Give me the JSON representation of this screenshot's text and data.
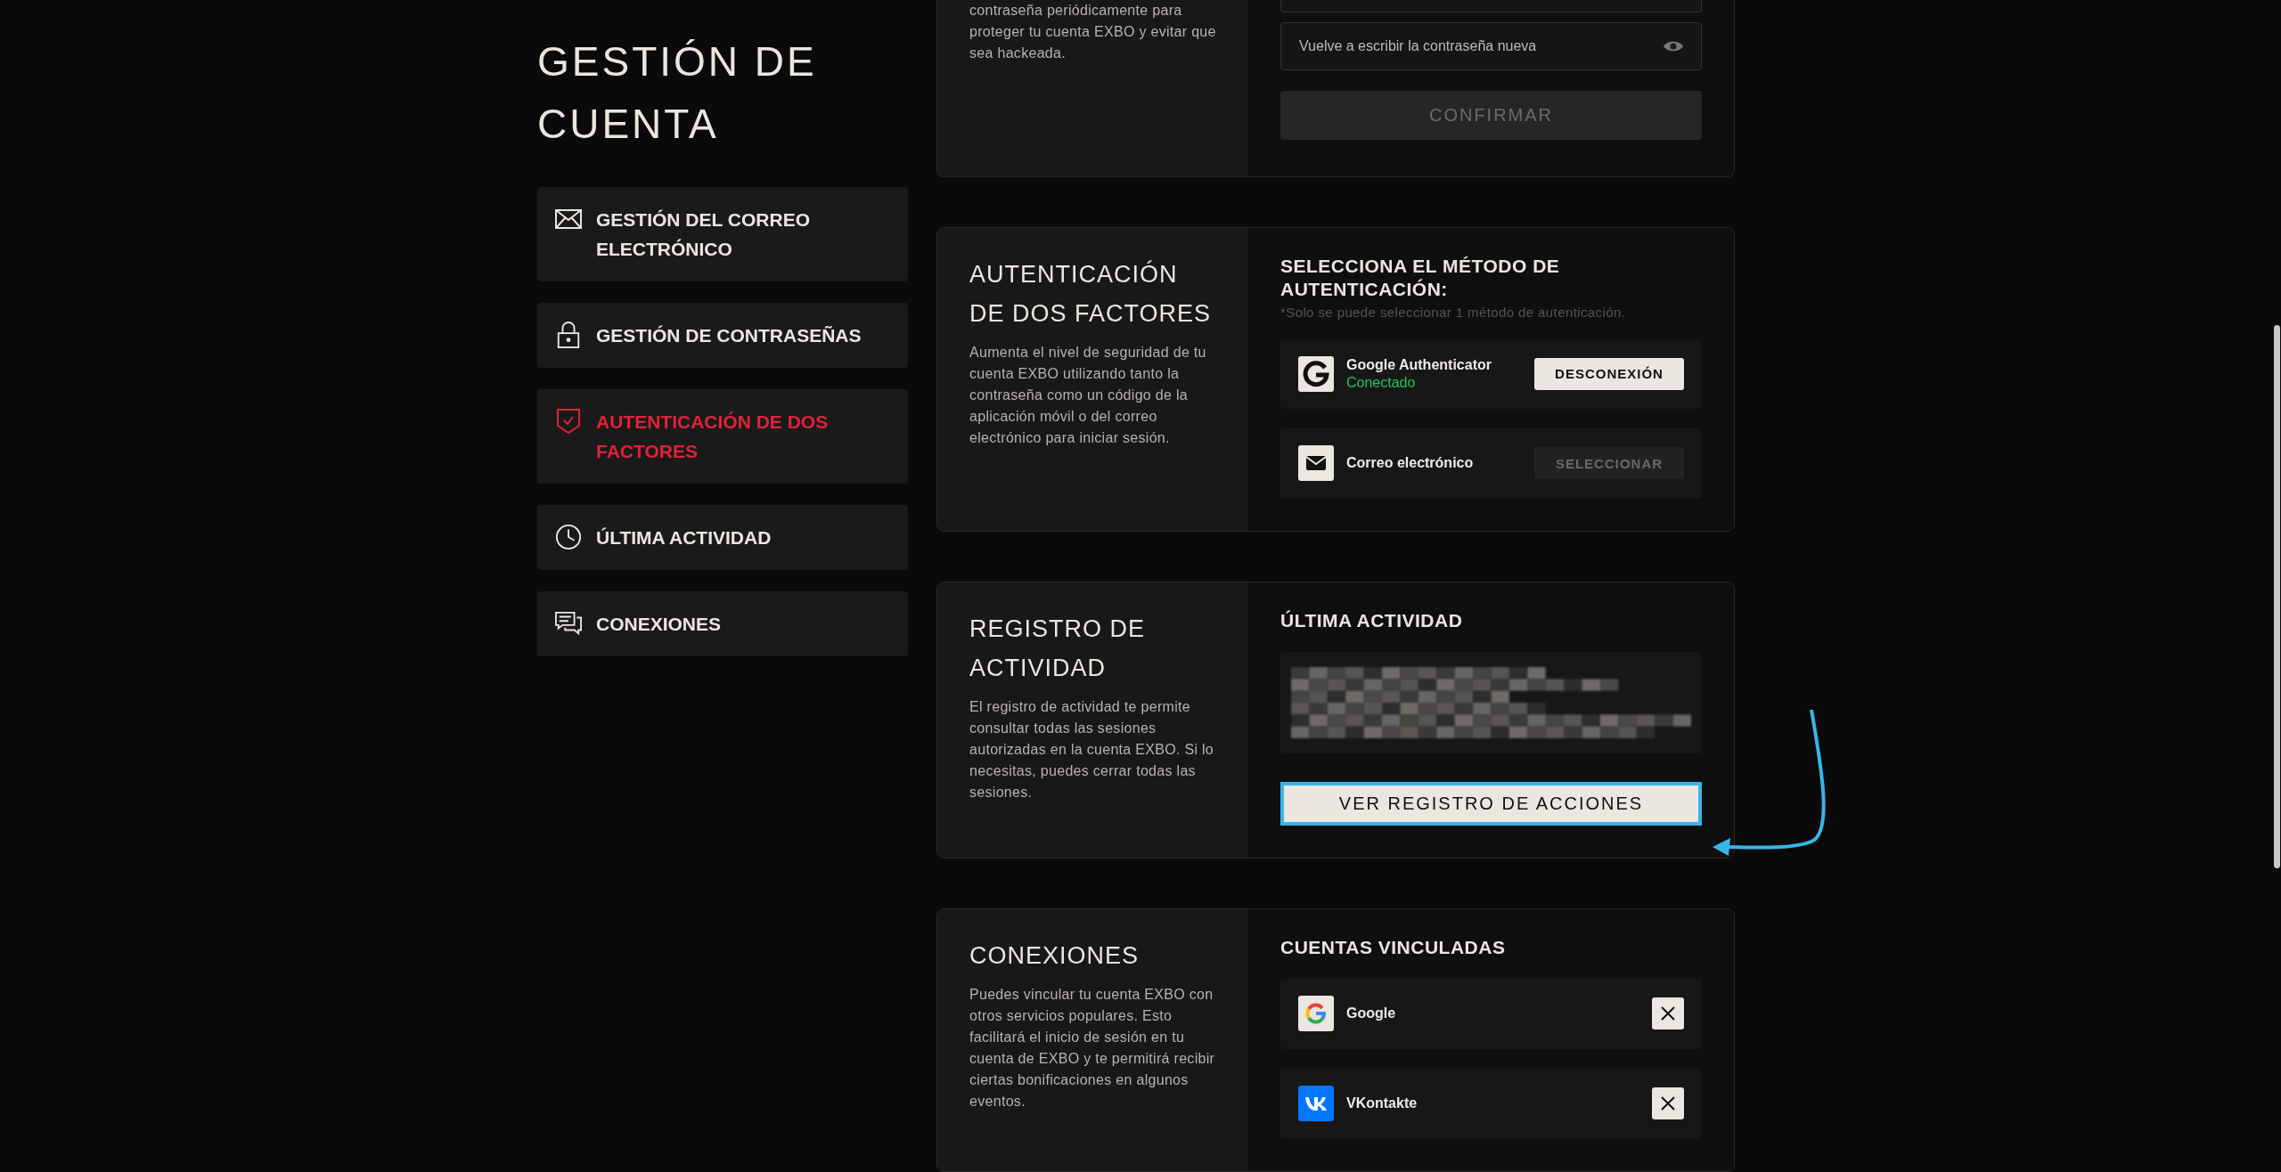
{
  "sidebar": {
    "title": "GESTIÓN DE CUENTA",
    "items": [
      {
        "label": "GESTIÓN DEL CORREO ELECTRÓNICO",
        "kind": "mail",
        "selected": false
      },
      {
        "label": "GESTIÓN DE CONTRASEÑAS",
        "kind": "lock",
        "selected": false
      },
      {
        "label": "AUTENTICACIÓN DE DOS FACTORES",
        "kind": "shield",
        "selected": true
      },
      {
        "label": "ÚLTIMA ACTIVIDAD",
        "kind": "clock",
        "selected": false
      },
      {
        "label": "CONEXIONES",
        "kind": "chat",
        "selected": false
      }
    ]
  },
  "password": {
    "description": "contraseña periódicamente para proteger tu cuenta EXBO y evitar que sea hackeada.",
    "repeat_field": {
      "placeholder": "Vuelve a escribir la contraseña nueva"
    },
    "confirm_button": {
      "label": "CONFIRMAR",
      "disabled": true
    }
  },
  "two_factor": {
    "title": "AUTENTICACIÓN DE DOS FACTORES",
    "description": "Aumenta el nivel de seguridad de tu cuenta EXBO utilizando tanto la contraseña como un código de la aplicación móvil o del correo electrónico para iniciar sesión.",
    "heading": "SELECCIONA EL MÉTODO DE AUTENTICACIÓN:",
    "note": "*Solo se puede seleccionar 1 método de autenticación.",
    "methods": [
      {
        "name": "Google Authenticator",
        "status": "Conectado",
        "kind": "authenticator",
        "button": "DESCONEXIÓN",
        "connected": true
      },
      {
        "name": "Correo electrónico",
        "kind": "mail",
        "button": "SELECCIONAR",
        "connected": false
      }
    ]
  },
  "activity": {
    "title": "REGISTRO DE ACTIVIDAD",
    "description": "El registro de actividad te permite consultar todas las sesiones autorizadas en la cuenta EXBO. Si lo necesitas, puedes cerrar todas las sesiones.",
    "heading": "ÚLTIMA ACTIVIDAD",
    "button": {
      "label": "VER REGISTRO DE ACCIONES",
      "focused": true
    }
  },
  "connections": {
    "title": "CONEXIONES",
    "description": "Puedes vincular tu cuenta EXBO con otros servicios populares. Esto facilitará el inicio de sesión en tu cuenta de EXBO y te permitirá recibir ciertas bonificaciones en algunos eventos.",
    "heading": "CUENTAS VINCULADAS",
    "accounts": [
      {
        "name": "Google",
        "kind": "google"
      },
      {
        "name": "VKontakte",
        "kind": "vk"
      }
    ]
  }
}
